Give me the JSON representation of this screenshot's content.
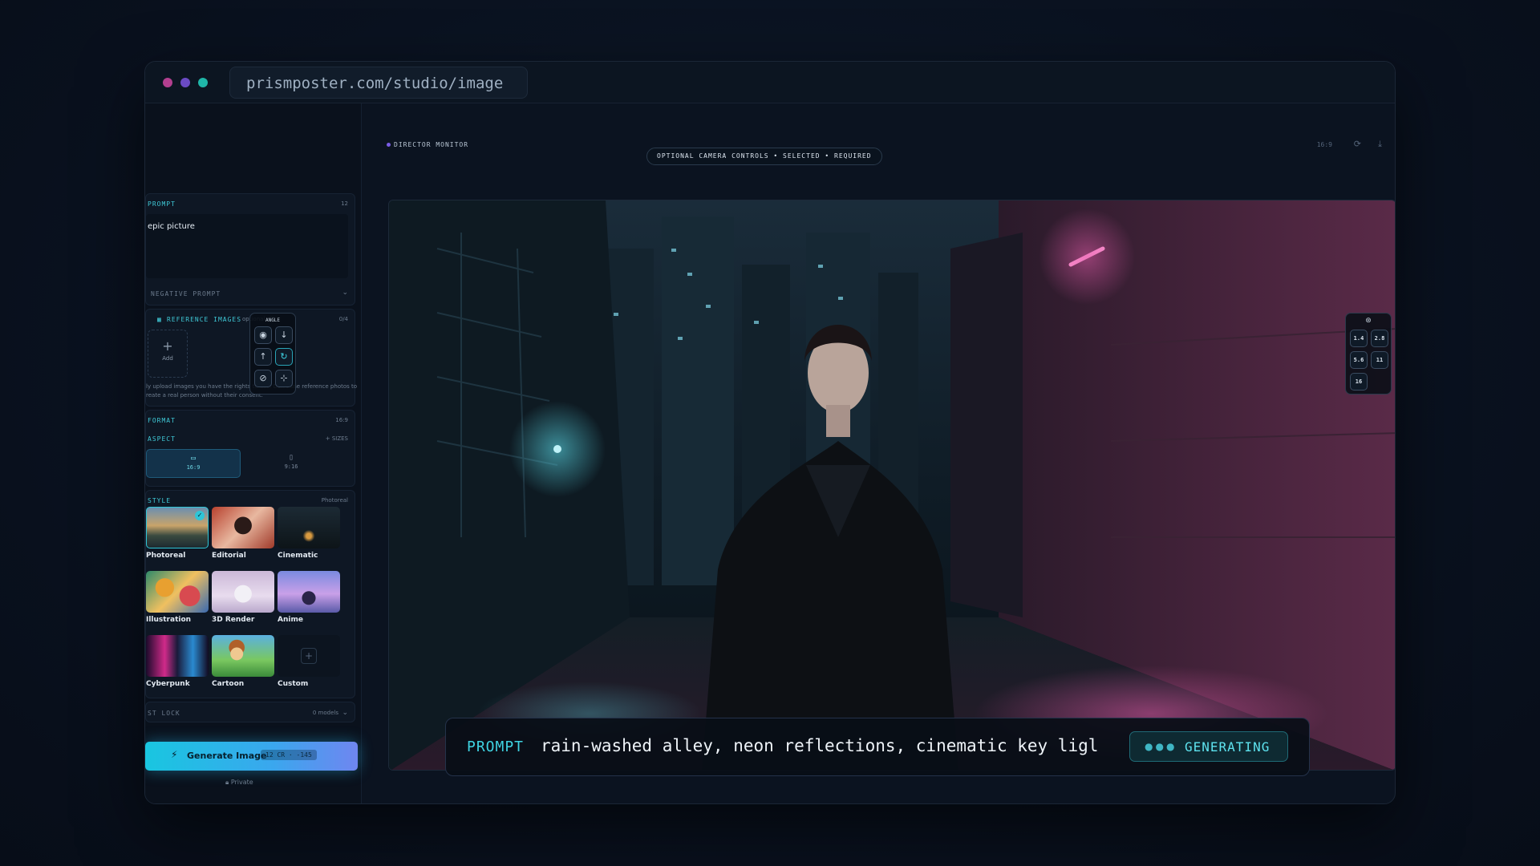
{
  "browser": {
    "url": "prismposter.com/studio/image"
  },
  "sidebar": {
    "prompt": {
      "label": "PROMPT",
      "count": "12",
      "value": "epic picture"
    },
    "negative_prompt_label": "NEGATIVE PROMPT",
    "reference": {
      "label": "REFERENCE IMAGES",
      "optional": "optional",
      "count": "0/4",
      "add_label": "Add",
      "note_line1": "ly upload images you have the rights to use. Don't use reference photos to",
      "note_line2": "reate a real person without their consent."
    },
    "format": {
      "label": "FORMAT",
      "value": "16:9",
      "aspect_label": "ASPECT",
      "sizes_label": "+ SIZES",
      "options": [
        "16:9",
        "9:16"
      ]
    },
    "style": {
      "label": "STYLE",
      "selected": "Photoreal",
      "tiles": [
        "Photoreal",
        "Editorial",
        "Cinematic",
        "Illustration",
        "3D Render",
        "Anime",
        "Cyberpunk",
        "Cartoon",
        "Custom"
      ]
    },
    "lock": {
      "label": "ST LOCK",
      "value": "0 models"
    },
    "generate": {
      "label": "Generate Image",
      "cost": "12 CR · -145"
    },
    "privacy": "Private"
  },
  "monitor": {
    "title": "DIRECTOR MONITOR",
    "ratio": "16:9",
    "chip": "OPTIONAL CAMERA CONTROLS • SELECTED • REQUIRED",
    "angle_title": "ANGLE",
    "fstops": [
      "1.4",
      "2.8",
      "5.6",
      "11",
      "16"
    ]
  },
  "prompt_bar": {
    "label": "PROMPT",
    "text": "rain-washed alley, neon reflections, cinematic key ligl",
    "status": "GENERATING"
  },
  "colors": {
    "accent": "#3fd3e2",
    "brand_purple": "#7a5ce6",
    "neon_pink": "#e05aa8"
  }
}
